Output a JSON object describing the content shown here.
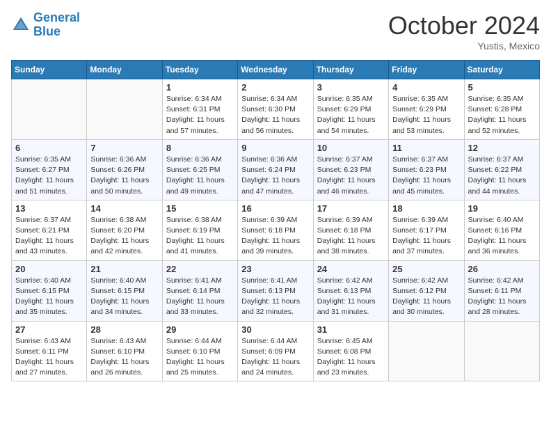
{
  "header": {
    "logo_line1": "General",
    "logo_line2": "Blue",
    "month": "October 2024",
    "location": "Yustis, Mexico"
  },
  "days_of_week": [
    "Sunday",
    "Monday",
    "Tuesday",
    "Wednesday",
    "Thursday",
    "Friday",
    "Saturday"
  ],
  "weeks": [
    [
      {
        "day": "",
        "empty": true
      },
      {
        "day": "",
        "empty": true
      },
      {
        "day": "1",
        "sunrise": "Sunrise: 6:34 AM",
        "sunset": "Sunset: 6:31 PM",
        "daylight": "Daylight: 11 hours and 57 minutes."
      },
      {
        "day": "2",
        "sunrise": "Sunrise: 6:34 AM",
        "sunset": "Sunset: 6:30 PM",
        "daylight": "Daylight: 11 hours and 56 minutes."
      },
      {
        "day": "3",
        "sunrise": "Sunrise: 6:35 AM",
        "sunset": "Sunset: 6:29 PM",
        "daylight": "Daylight: 11 hours and 54 minutes."
      },
      {
        "day": "4",
        "sunrise": "Sunrise: 6:35 AM",
        "sunset": "Sunset: 6:29 PM",
        "daylight": "Daylight: 11 hours and 53 minutes."
      },
      {
        "day": "5",
        "sunrise": "Sunrise: 6:35 AM",
        "sunset": "Sunset: 6:28 PM",
        "daylight": "Daylight: 11 hours and 52 minutes."
      }
    ],
    [
      {
        "day": "6",
        "sunrise": "Sunrise: 6:35 AM",
        "sunset": "Sunset: 6:27 PM",
        "daylight": "Daylight: 11 hours and 51 minutes."
      },
      {
        "day": "7",
        "sunrise": "Sunrise: 6:36 AM",
        "sunset": "Sunset: 6:26 PM",
        "daylight": "Daylight: 11 hours and 50 minutes."
      },
      {
        "day": "8",
        "sunrise": "Sunrise: 6:36 AM",
        "sunset": "Sunset: 6:25 PM",
        "daylight": "Daylight: 11 hours and 49 minutes."
      },
      {
        "day": "9",
        "sunrise": "Sunrise: 6:36 AM",
        "sunset": "Sunset: 6:24 PM",
        "daylight": "Daylight: 11 hours and 47 minutes."
      },
      {
        "day": "10",
        "sunrise": "Sunrise: 6:37 AM",
        "sunset": "Sunset: 6:23 PM",
        "daylight": "Daylight: 11 hours and 46 minutes."
      },
      {
        "day": "11",
        "sunrise": "Sunrise: 6:37 AM",
        "sunset": "Sunset: 6:23 PM",
        "daylight": "Daylight: 11 hours and 45 minutes."
      },
      {
        "day": "12",
        "sunrise": "Sunrise: 6:37 AM",
        "sunset": "Sunset: 6:22 PM",
        "daylight": "Daylight: 11 hours and 44 minutes."
      }
    ],
    [
      {
        "day": "13",
        "sunrise": "Sunrise: 6:37 AM",
        "sunset": "Sunset: 6:21 PM",
        "daylight": "Daylight: 11 hours and 43 minutes."
      },
      {
        "day": "14",
        "sunrise": "Sunrise: 6:38 AM",
        "sunset": "Sunset: 6:20 PM",
        "daylight": "Daylight: 11 hours and 42 minutes."
      },
      {
        "day": "15",
        "sunrise": "Sunrise: 6:38 AM",
        "sunset": "Sunset: 6:19 PM",
        "daylight": "Daylight: 11 hours and 41 minutes."
      },
      {
        "day": "16",
        "sunrise": "Sunrise: 6:39 AM",
        "sunset": "Sunset: 6:18 PM",
        "daylight": "Daylight: 11 hours and 39 minutes."
      },
      {
        "day": "17",
        "sunrise": "Sunrise: 6:39 AM",
        "sunset": "Sunset: 6:18 PM",
        "daylight": "Daylight: 11 hours and 38 minutes."
      },
      {
        "day": "18",
        "sunrise": "Sunrise: 6:39 AM",
        "sunset": "Sunset: 6:17 PM",
        "daylight": "Daylight: 11 hours and 37 minutes."
      },
      {
        "day": "19",
        "sunrise": "Sunrise: 6:40 AM",
        "sunset": "Sunset: 6:16 PM",
        "daylight": "Daylight: 11 hours and 36 minutes."
      }
    ],
    [
      {
        "day": "20",
        "sunrise": "Sunrise: 6:40 AM",
        "sunset": "Sunset: 6:15 PM",
        "daylight": "Daylight: 11 hours and 35 minutes."
      },
      {
        "day": "21",
        "sunrise": "Sunrise: 6:40 AM",
        "sunset": "Sunset: 6:15 PM",
        "daylight": "Daylight: 11 hours and 34 minutes."
      },
      {
        "day": "22",
        "sunrise": "Sunrise: 6:41 AM",
        "sunset": "Sunset: 6:14 PM",
        "daylight": "Daylight: 11 hours and 33 minutes."
      },
      {
        "day": "23",
        "sunrise": "Sunrise: 6:41 AM",
        "sunset": "Sunset: 6:13 PM",
        "daylight": "Daylight: 11 hours and 32 minutes."
      },
      {
        "day": "24",
        "sunrise": "Sunrise: 6:42 AM",
        "sunset": "Sunset: 6:13 PM",
        "daylight": "Daylight: 11 hours and 31 minutes."
      },
      {
        "day": "25",
        "sunrise": "Sunrise: 6:42 AM",
        "sunset": "Sunset: 6:12 PM",
        "daylight": "Daylight: 11 hours and 30 minutes."
      },
      {
        "day": "26",
        "sunrise": "Sunrise: 6:42 AM",
        "sunset": "Sunset: 6:11 PM",
        "daylight": "Daylight: 11 hours and 28 minutes."
      }
    ],
    [
      {
        "day": "27",
        "sunrise": "Sunrise: 6:43 AM",
        "sunset": "Sunset: 6:11 PM",
        "daylight": "Daylight: 11 hours and 27 minutes."
      },
      {
        "day": "28",
        "sunrise": "Sunrise: 6:43 AM",
        "sunset": "Sunset: 6:10 PM",
        "daylight": "Daylight: 11 hours and 26 minutes."
      },
      {
        "day": "29",
        "sunrise": "Sunrise: 6:44 AM",
        "sunset": "Sunset: 6:10 PM",
        "daylight": "Daylight: 11 hours and 25 minutes."
      },
      {
        "day": "30",
        "sunrise": "Sunrise: 6:44 AM",
        "sunset": "Sunset: 6:09 PM",
        "daylight": "Daylight: 11 hours and 24 minutes."
      },
      {
        "day": "31",
        "sunrise": "Sunrise: 6:45 AM",
        "sunset": "Sunset: 6:08 PM",
        "daylight": "Daylight: 11 hours and 23 minutes."
      },
      {
        "day": "",
        "empty": true
      },
      {
        "day": "",
        "empty": true
      }
    ]
  ]
}
